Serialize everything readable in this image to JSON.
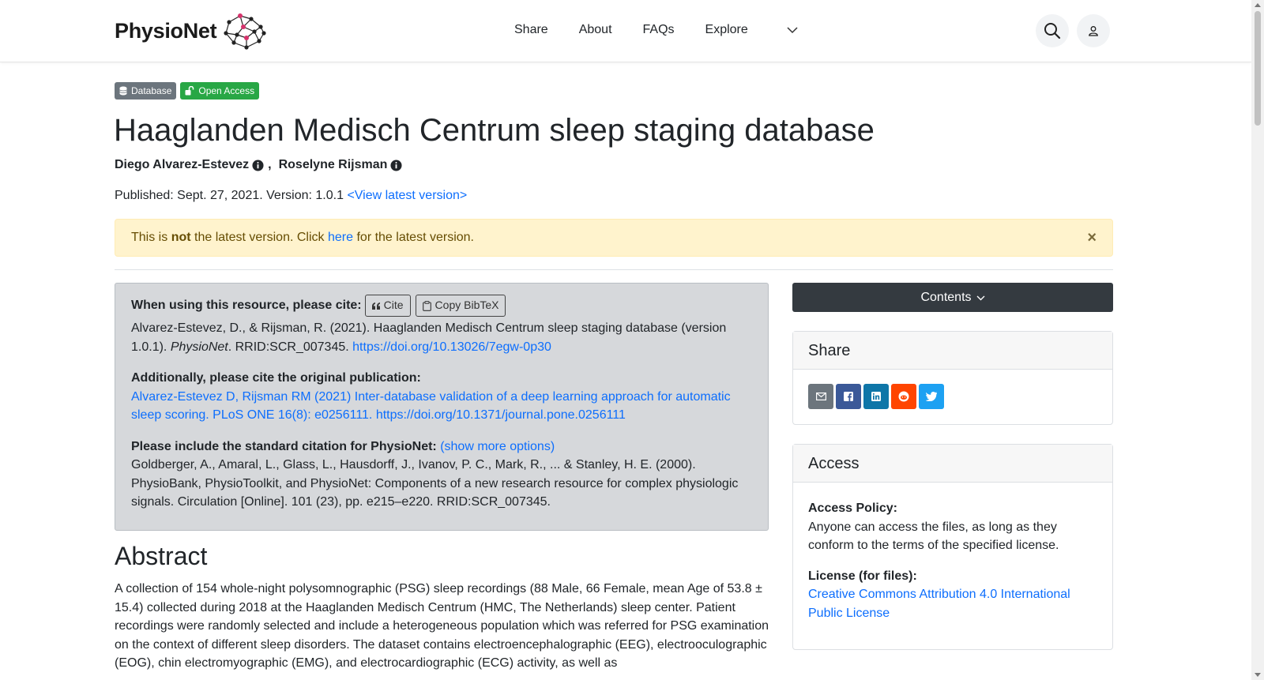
{
  "header": {
    "brand": "PhysioNet",
    "nav": [
      "Share",
      "About",
      "FAQs",
      "Explore"
    ]
  },
  "badges": {
    "database": "Database",
    "open_access": "Open Access"
  },
  "title": "Haaglanden Medisch Centrum sleep staging database",
  "authors": [
    "Diego Alvarez-Estevez",
    "Roselyne Rijsman"
  ],
  "author_separator": ",",
  "published": {
    "text": "Published: Sept. 27, 2021. Version: 1.0.1",
    "latest_link": "<View latest version>"
  },
  "alert": {
    "prefix": "This is",
    "bold": "not",
    "middle": "the latest version. Click",
    "link": "here",
    "suffix": "for the latest version.",
    "close": "×"
  },
  "citation": {
    "heading": "When using this resource, please cite:",
    "cite_btn": "Cite",
    "bibtex_btn": "Copy BibTeX",
    "text_a": "Alvarez-Estevez, D., & Rijsman, R. (2021). Haaglanden Medisch Centrum sleep staging database (version 1.0.1).",
    "text_em": "PhysioNet",
    "text_b": ". RRID:SCR_007345.",
    "doi": "https://doi.org/10.13026/7egw-0p30",
    "original_heading": "Additionally, please cite the original publication:",
    "original_link": "Alvarez-Estevez D, Rijsman RM (2021) Inter-database validation of a deep learning approach for automatic sleep scoring. PLoS ONE 16(8): e0256111. https://doi.org/10.1371/journal.pone.0256111",
    "standard_heading": "Please include the standard citation for PhysioNet:",
    "show_more": "(show more options)",
    "standard_text": "Goldberger, A., Amaral, L., Glass, L., Hausdorff, J., Ivanov, P. C., Mark, R., ... & Stanley, H. E. (2000). PhysioBank, PhysioToolkit, and PhysioNet: Components of a new research resource for complex physiologic signals. Circulation [Online]. 101 (23), pp. e215–e220. RRID:SCR_007345."
  },
  "abstract": {
    "title": "Abstract",
    "text": "A collection of 154 whole-night polysomnographic (PSG) sleep recordings (88 Male, 66 Female, mean Age of 53.8 ± 15.4) collected during 2018 at the Haaglanden Medisch Centrum (HMC, The Netherlands) sleep center. Patient recordings were randomly selected and include a heterogeneous population which was referred for PSG examination on the context of different sleep disorders. The dataset contains electroencephalographic (EEG), electrooculographic (EOG), chin electromyographic (EMG), and electrocardiographic (ECG) activity, as well as"
  },
  "sidebar": {
    "contents": "Contents",
    "share_title": "Share",
    "access_title": "Access",
    "access_policy_label": "Access Policy:",
    "access_policy_text": "Anyone can access the files, as long as they conform to the terms of the specified license.",
    "license_label": "License (for files):",
    "license_link": "Creative Commons Attribution 4.0 International Public License"
  },
  "colors": {
    "email": "#6c757d",
    "facebook": "#3b5998",
    "linkedin": "#0e76a8",
    "reddit": "#ff4500",
    "twitter": "#1da1f2",
    "badge_db": "#6c757d",
    "badge_oa": "#28a745"
  }
}
